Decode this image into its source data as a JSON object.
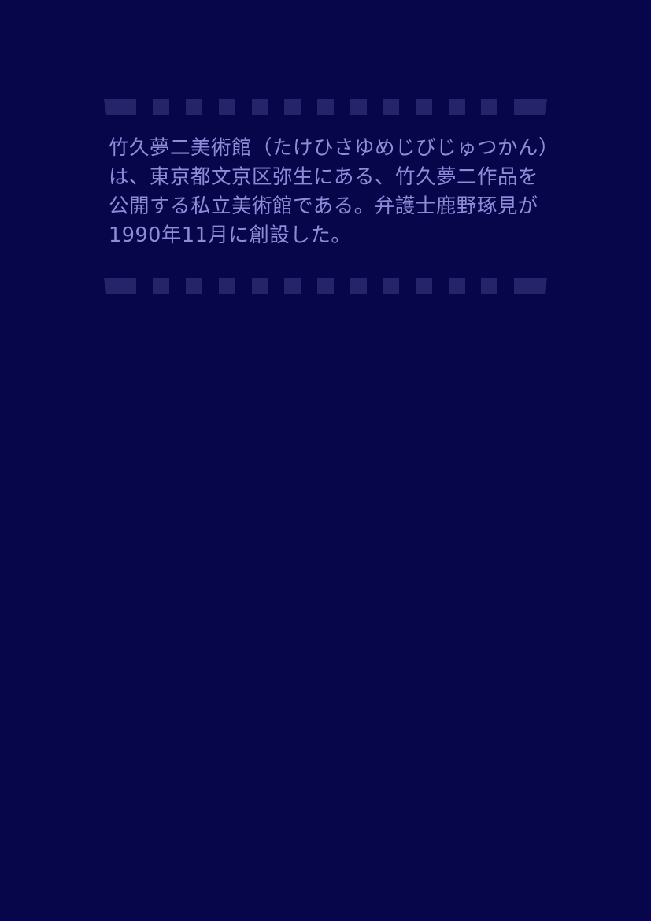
{
  "document": {
    "paragraph": "竹久夢二美術館（たけひさゆめじびじゅつかん）は、東京都文京区弥生にある、竹久夢二作品を公開する私立美術館である。弁護士鹿野琢見が1990年11月に創設した。"
  },
  "colors": {
    "background": "#07064a",
    "text": "#8f8bd8",
    "divider": "#25246a"
  }
}
